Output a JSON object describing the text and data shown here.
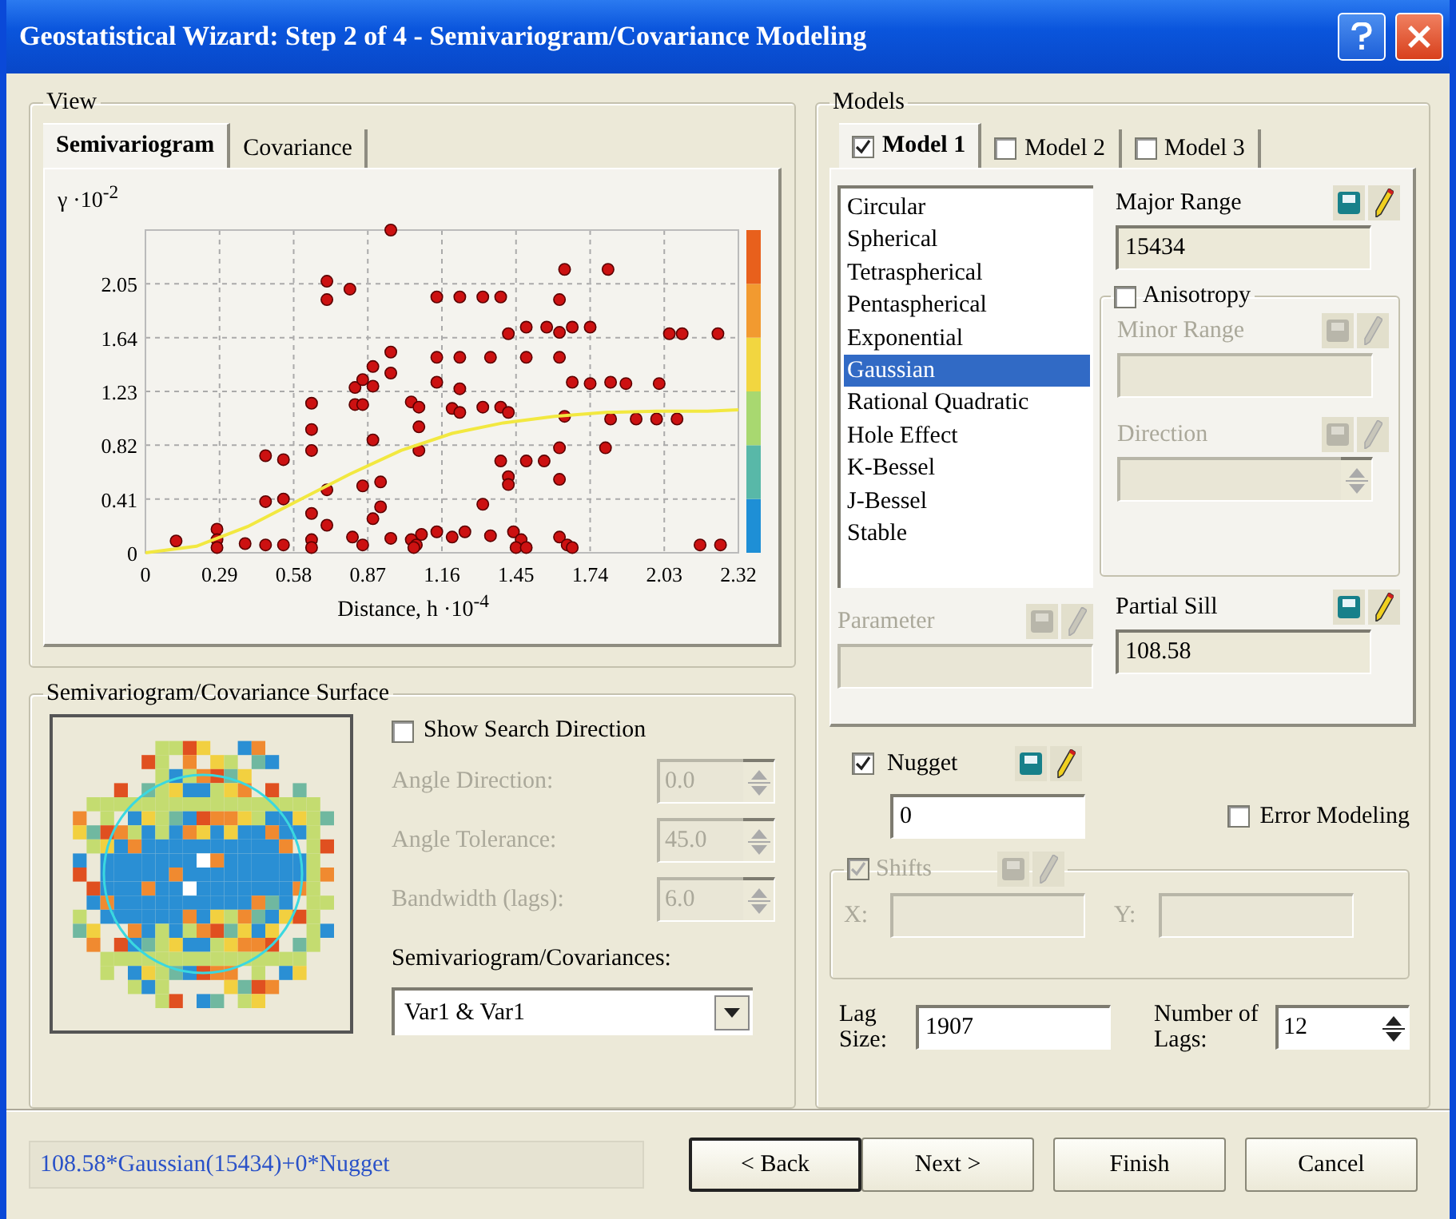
{
  "window": {
    "title": "Geostatistical Wizard: Step 2 of 4 - Semivariogram/Covariance Modeling"
  },
  "view": {
    "title": "View",
    "tabs": [
      {
        "label": "Semivariogram",
        "selected": true
      },
      {
        "label": "Covariance",
        "selected": false
      }
    ],
    "chart_data": {
      "type": "scatter",
      "grid": true,
      "xlabel": "Distance, h ·10$^{-4}$",
      "ylabel": "γ ·10$^{-2}$",
      "xlim": [
        0,
        2.32
      ],
      "ylim": [
        0,
        2.46
      ],
      "xticks": [
        0,
        0.29,
        0.58,
        0.87,
        1.16,
        1.45,
        1.74,
        2.03,
        2.32
      ],
      "yticks": [
        0,
        0.41,
        0.82,
        1.23,
        1.64,
        2.05
      ],
      "series": [
        {
          "color": "#cc1111",
          "x": [
            0.12,
            0.28,
            0.28,
            0.28,
            0.39,
            0.47,
            0.54,
            0.47,
            0.54,
            0.47,
            0.54,
            0.65,
            0.65,
            0.65,
            0.65,
            0.65,
            0.65,
            0.71,
            0.71,
            0.71,
            0.71,
            0.8,
            0.82,
            0.85,
            0.82,
            0.85,
            0.89,
            0.89,
            0.89,
            0.85,
            0.92,
            0.81,
            0.85,
            0.92,
            0.89,
            0.96,
            0.96,
            0.96,
            0.96,
            1.04,
            1.07,
            1.07,
            1.07,
            1.04,
            1.06,
            1.08,
            1.05,
            1.14,
            1.23,
            1.32,
            1.39,
            1.14,
            1.23,
            1.35,
            1.14,
            1.23,
            1.2,
            1.23,
            1.14,
            1.2,
            1.25,
            1.32,
            1.32,
            1.35,
            1.39,
            1.42,
            1.42,
            1.49,
            1.49,
            1.39,
            1.49,
            1.56,
            1.42,
            1.42,
            1.44,
            1.47,
            1.45,
            1.49,
            1.57,
            1.62,
            1.62,
            1.62,
            1.64,
            1.62,
            1.62,
            1.64,
            1.62,
            1.65,
            1.67,
            1.67,
            1.74,
            1.67,
            1.74,
            1.81,
            1.82,
            1.88,
            1.8,
            1.82,
            1.92,
            2.0,
            2.01,
            2.08,
            2.05,
            2.1,
            2.24,
            2.17,
            2.25
          ],
          "values": [
            0.09,
            0.18,
            0.1,
            0.04,
            0.07,
            0.06,
            0.06,
            0.74,
            0.71,
            0.39,
            0.41,
            1.14,
            0.94,
            0.78,
            0.3,
            0.1,
            0.04,
            2.07,
            1.93,
            0.48,
            0.21,
            2.01,
            1.13,
            1.13,
            1.26,
            1.32,
            1.42,
            1.27,
            0.86,
            0.51,
            0.54,
            0.12,
            0.06,
            0.35,
            0.26,
            2.46,
            1.53,
            1.37,
            0.11,
            1.15,
            1.11,
            0.96,
            0.78,
            0.1,
            0.06,
            0.14,
            0.04,
            1.95,
            1.95,
            1.95,
            1.95,
            1.49,
            1.49,
            1.49,
            1.3,
            1.25,
            1.1,
            1.07,
            0.16,
            0.12,
            0.16,
            1.11,
            0.37,
            0.13,
            1.11,
            1.07,
            1.67,
            1.72,
            1.49,
            0.7,
            0.7,
            0.7,
            0.58,
            0.52,
            0.16,
            0.1,
            0.04,
            0.04,
            1.72,
            1.68,
            1.93,
            1.49,
            2.16,
            0.8,
            0.56,
            1.04,
            0.12,
            0.06,
            0.04,
            1.72,
            1.72,
            1.3,
            1.29,
            2.16,
            1.3,
            1.29,
            0.8,
            1.02,
            1.02,
            1.02,
            1.29,
            1.02,
            1.67,
            1.67,
            1.67,
            0.06,
            0.06
          ]
        },
        {
          "type": "line",
          "color": "#f2e840",
          "x": [
            0,
            0.2,
            0.4,
            0.6,
            0.8,
            1.0,
            1.2,
            1.4,
            1.6,
            1.8,
            2.0,
            2.2,
            2.32
          ],
          "values": [
            0,
            0.05,
            0.2,
            0.4,
            0.6,
            0.78,
            0.91,
            0.99,
            1.04,
            1.07,
            1.08,
            1.08,
            1.09
          ]
        }
      ]
    }
  },
  "surface": {
    "title": "Semivariogram/Covariance Surface",
    "show_search_direction": {
      "label": "Show Search Direction",
      "checked": false
    },
    "spinners": [
      {
        "label": "Angle Direction:",
        "value": "0.0",
        "disabled": true
      },
      {
        "label": "Angle Tolerance:",
        "value": "45.0",
        "disabled": true
      },
      {
        "label": "Bandwidth (lags):",
        "value": "6.0",
        "disabled": true
      }
    ],
    "covariances": {
      "label": "Semivariogram/Covariances:",
      "value": "Var1 & Var1"
    }
  },
  "models": {
    "title": "Models",
    "tabs": [
      {
        "label": "Model 1",
        "checked": true,
        "selected": true
      },
      {
        "label": "Model 2",
        "checked": false,
        "selected": false
      },
      {
        "label": "Model 3",
        "checked": false,
        "selected": false
      }
    ],
    "types": [
      {
        "label": "Circular",
        "selected": false
      },
      {
        "label": "Spherical",
        "selected": false
      },
      {
        "label": "Tetraspherical",
        "selected": false
      },
      {
        "label": "Pentaspherical",
        "selected": false
      },
      {
        "label": "Exponential",
        "selected": false
      },
      {
        "label": "Gaussian",
        "selected": true
      },
      {
        "label": "Rational Quadratic",
        "selected": false
      },
      {
        "label": "Hole Effect",
        "selected": false
      },
      {
        "label": "K-Bessel",
        "selected": false
      },
      {
        "label": "J-Bessel",
        "selected": false
      },
      {
        "label": "Stable",
        "selected": false
      }
    ],
    "major_range": {
      "label": "Major Range",
      "value": "15434",
      "disabled": false,
      "editable": false
    },
    "anisotropy": {
      "label": "Anisotropy",
      "checked": false
    },
    "minor_range": {
      "label": "Minor Range",
      "disabled": true
    },
    "direction": {
      "label": "Direction",
      "disabled": true
    },
    "parameter": {
      "label": "Parameter",
      "disabled": true
    },
    "partial_sill": {
      "label": "Partial Sill",
      "value": "108.58",
      "disabled": false,
      "editable": false
    },
    "nugget": {
      "label": "Nugget",
      "checked": true,
      "value": "0",
      "disabled": false,
      "editable": true
    },
    "error_modeling": {
      "label": "Error Modeling",
      "checked": false
    },
    "shifts": {
      "label": "Shifts",
      "checked": true,
      "disabled": true,
      "fields": [
        {
          "label": "X:"
        },
        {
          "label": "Y:"
        }
      ]
    },
    "lag_size": {
      "label": "Lag Size:",
      "value": "1907"
    },
    "number_of_lags": {
      "label": "Number of Lags:",
      "value": "12"
    }
  },
  "status": "108.58*Gaussian(15434)+0*Nugget",
  "buttons": [
    {
      "label": "< Back",
      "default": true
    },
    {
      "label": "Next >",
      "default": false
    },
    {
      "label": "Finish",
      "default": false
    },
    {
      "label": "Cancel",
      "default": false
    }
  ]
}
